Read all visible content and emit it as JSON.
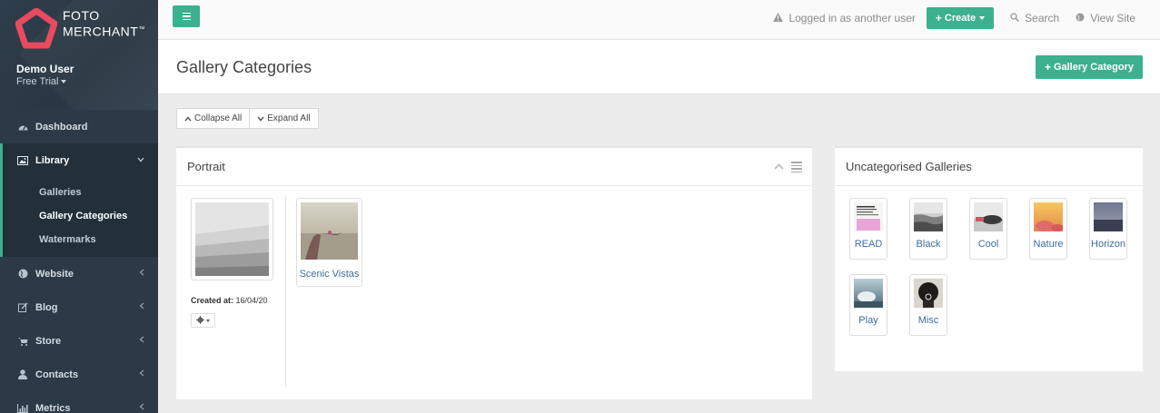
{
  "brand": {
    "line1": "FOTO",
    "line2": "MERCHANT",
    "tm": "™",
    "accent": "#e84a5f"
  },
  "user": {
    "name": "Demo User",
    "plan": "Free Trial"
  },
  "nav": {
    "dashboard": "Dashboard",
    "library": "Library",
    "library_sub": {
      "galleries": "Galleries",
      "gallery_categories": "Gallery Categories",
      "watermarks": "Watermarks"
    },
    "website": "Website",
    "blog": "Blog",
    "store": "Store",
    "contacts": "Contacts",
    "metrics": "Metrics"
  },
  "topbar": {
    "logged_in": "Logged in as another user",
    "create": "Create",
    "search": "Search",
    "view_site": "View Site"
  },
  "header": {
    "title": "Gallery Categories",
    "add_button": "Gallery Category"
  },
  "toolbar": {
    "collapse_all": "Collapse All",
    "expand_all": "Expand All"
  },
  "portrait_panel": {
    "title": "Portrait",
    "created_label": "Created at:",
    "created_value": "16/04/20",
    "galleries": [
      {
        "label": "Scenic Vistas"
      }
    ]
  },
  "uncategorised_panel": {
    "title": "Uncategorised Galleries",
    "galleries": [
      {
        "label": "READ"
      },
      {
        "label": "Black"
      },
      {
        "label": "Cool"
      },
      {
        "label": "Nature"
      },
      {
        "label": "Horizon"
      },
      {
        "label": "Play"
      },
      {
        "label": "Misc"
      }
    ]
  },
  "colors": {
    "sidebar_bg": "#2c3a47",
    "primary_green": "#3cb08f",
    "link_blue": "#3b6e9c"
  }
}
